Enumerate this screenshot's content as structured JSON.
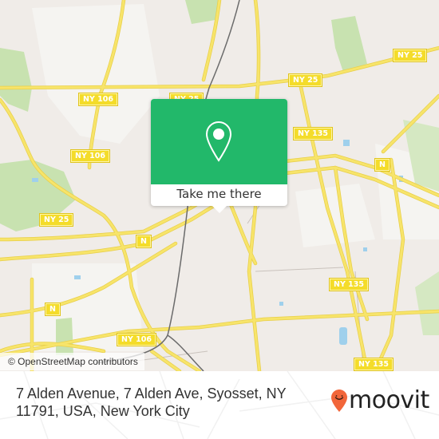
{
  "map": {
    "attribution": "© OpenStreetMap contributors",
    "shields": [
      {
        "label": "NY 25",
        "id": "ny25-top-right"
      },
      {
        "label": "NY 106",
        "id": "ny106-top-left"
      },
      {
        "label": "NY 25",
        "id": "ny25-top-center"
      },
      {
        "label": "NY 25",
        "id": "ny25-center"
      },
      {
        "label": "NY 135",
        "id": "ny135-top"
      },
      {
        "label": "NY 106",
        "id": "ny106-left"
      },
      {
        "label": "NY 25",
        "id": "ny25-left"
      },
      {
        "label": "N",
        "id": "n-center-left"
      },
      {
        "label": "N",
        "id": "n-right"
      },
      {
        "label": "NY 135",
        "id": "ny135-center-right"
      },
      {
        "label": "N",
        "id": "n-lower-left"
      },
      {
        "label": "NY 106",
        "id": "ny106-bottom"
      },
      {
        "label": "NY 135",
        "id": "ny135-bottom-right"
      }
    ],
    "colors": {
      "land": "#f0ece8",
      "road": "#f7e46a",
      "park": "#c8e2b0",
      "water": "#9fd0ec",
      "rail": "#6b6b6b"
    }
  },
  "popup": {
    "button_label": "Take me there",
    "icon": "location-pin-icon",
    "color": "#22b86a"
  },
  "footer": {
    "address": "7 Alden Avenue, 7 Alden Ave, Syosset, NY 11791, USA, New York City",
    "logo_text": "moovit",
    "logo_icon": "moovit-pin-icon",
    "logo_color": "#f2663a"
  }
}
